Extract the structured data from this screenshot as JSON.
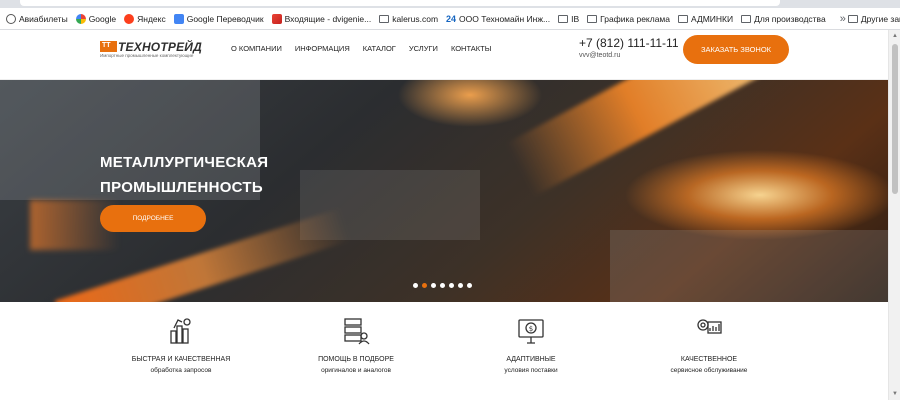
{
  "bookmarks": [
    {
      "label": "Авиабилеты",
      "icon": "globe-icon"
    },
    {
      "label": "Google",
      "icon": "google-icon"
    },
    {
      "label": "Яндекс",
      "icon": "yandex-icon"
    },
    {
      "label": "Google Переводчик",
      "icon": "translate-icon"
    },
    {
      "label": "Входящие - dvigenie...",
      "icon": "gmail-icon"
    },
    {
      "label": "kalerus.com",
      "icon": "folder-icon"
    },
    {
      "label": "ООО Техномайн Инж...",
      "icon": "n24-icon"
    },
    {
      "label": "IB",
      "icon": "folder-icon"
    },
    {
      "label": "Графика реклама",
      "icon": "folder-icon"
    },
    {
      "label": "АДМИНКИ",
      "icon": "folder-icon"
    },
    {
      "label": "Для производства",
      "icon": "folder-icon"
    }
  ],
  "bookmarks_overflow": "»",
  "bookmarks_other": "Другие закладки",
  "n24_badge": "24",
  "site": {
    "logo_mark": "TT",
    "logo_name": "ТЕХНОТРЕЙД",
    "logo_sub": "Импортные промышленные комплектующие",
    "nav": [
      "О КОМПАНИИ",
      "ИНФОРМАЦИЯ",
      "КАТАЛОГ",
      "УСЛУГИ",
      "КОНТАКТЫ"
    ],
    "phone": "+7 (812) 111-11-11",
    "email": "vvv@teotd.ru",
    "cta": "ЗАКАЗАТЬ ЗВОНОК"
  },
  "hero": {
    "title": "МЕТАЛЛУРГИЧЕСКАЯ\nПРОМЫШЛЕННОСТЬ",
    "button": "ПОДРОБНЕЕ",
    "slide_count": 7,
    "active_slide": 2
  },
  "features": [
    {
      "title": "БЫСТРАЯ И КАЧЕСТВЕННАЯ",
      "subtitle": "обработка запросов",
      "icon": "hand-icon"
    },
    {
      "title": "ПОМОЩЬ В ПОДБОРЕ",
      "subtitle": "оригиналов и аналогов",
      "icon": "server-user-icon"
    },
    {
      "title": "АДАПТИВНЫЕ",
      "subtitle": "условия поставки",
      "icon": "monitor-money-icon"
    },
    {
      "title": "КАЧЕСТВЕННОЕ",
      "subtitle": "сервисное обслуживание",
      "icon": "gear-chart-icon"
    }
  ],
  "colors": {
    "accent": "#e8700e",
    "text": "#222222"
  }
}
